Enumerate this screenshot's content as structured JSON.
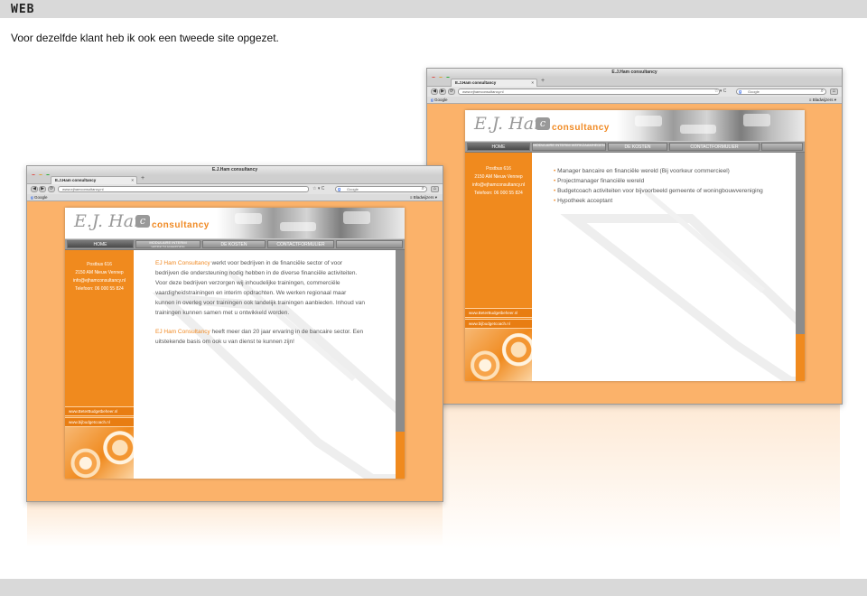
{
  "page": {
    "section_label": "WEB",
    "caption": "Voor dezelfde klant heb ik ook een tweede site opgezet."
  },
  "browser": {
    "window_title": "E.J.Ham consultancy",
    "tab_label": "E.J.Ham consultancy",
    "url": "www.ejhamconsultancy.nl",
    "search_placeholder": "Google",
    "bookmark_label": "Google",
    "bookmarks_menu": "Bladwijzers"
  },
  "site": {
    "logo_main": "E.J. Ham",
    "logo_badge": "c",
    "logo_word": "consultancy",
    "menu": [
      "HOME",
      "MODULAIRE INTERIM WERKZAAMHEDEN",
      "DE KOSTEN",
      "CONTACTFORMULIER"
    ],
    "address": [
      "Postbus 616",
      "2150 AM  Nieuw Vennep",
      "info@ejhamconsultancy.nl",
      "Telefoon: 06 000 55 824"
    ],
    "links": [
      "www.BeterBudgetbeheer.nl",
      "www.bijbudgetcoach.nl"
    ]
  },
  "left_site": {
    "intro_name": "EJ Ham Consultancy",
    "intro_text": " werkt voor bedrijven in de financiële sector of voor bedrijven die ondersteuning nodig hebben in de diverse financiële activiteiten. Voor deze bedrijven verzorgen wij inhoudelijke trainingen, commerciële vaardigheidstrainingen en interim opdrachten. We werken regionaal maar kunnen in overleg voor trainingen ook landelijk trainingen aanbieden. Inhoud van trainingen kunnen samen met u ontwikkeld worden.",
    "second_name": "EJ Ham Consultancy",
    "second_text": " heeft meer dan 20 jaar ervaring in de bancaire sector. Een uitstekende basis om ook u van dienst te kunnen zijn!"
  },
  "right_site": {
    "bullets": [
      "Manager bancaire en financiële wereld (Bij voorkeur commercieel)",
      "Projectmanager financiële wereld",
      "Budgetcoach activiteiten voor bijvoorbeeld gemeente of woningbouwvereniging",
      "Hypotheek acceptant"
    ]
  },
  "colors": {
    "accent": "#f08a1e",
    "page_bg": "#fbb26a",
    "menu_grey": "#9a9a9a"
  }
}
